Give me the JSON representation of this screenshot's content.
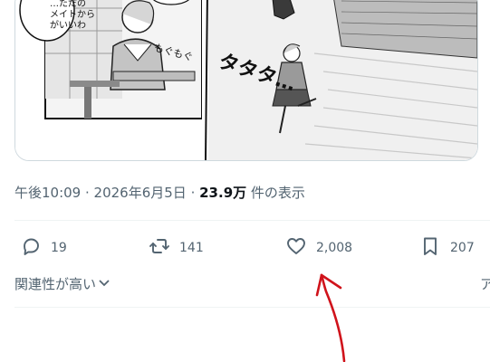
{
  "tweet": {
    "meta": {
      "time": "午後10:09",
      "sep1": " · ",
      "date": "2026年6月5日",
      "sep2": " · ",
      "views_count": "23.9万",
      "views_label": " 件の表示"
    },
    "media": {
      "manga_text": {
        "speech_bubble_lines": [
          "…ただの",
          "メイトから",
          "がいいわ"
        ],
        "sfx_mogumogu": "もぐもぐ",
        "sfx_tatata": "タタタ…"
      }
    },
    "actions": [
      {
        "name": "reply-button",
        "icon": "speech-bubble-icon",
        "count": "19"
      },
      {
        "name": "retweet-button",
        "icon": "retweet-icon",
        "count": "141"
      },
      {
        "name": "like-button",
        "icon": "heart-icon",
        "count": "2,008"
      },
      {
        "name": "bookmark-button",
        "icon": "bookmark-icon",
        "count": "207"
      }
    ],
    "sort": {
      "label": "関連性が高い",
      "icon": "chevron-down-icon"
    },
    "cut_off_text": "ア"
  },
  "annotation": {
    "color": "#d0131b",
    "icon": "hand-drawn-red-arrow"
  },
  "colors": {
    "text_secondary": "#536471",
    "text_primary": "#0f1419",
    "border": "#cfd9de",
    "divider": "#eff3f4"
  }
}
